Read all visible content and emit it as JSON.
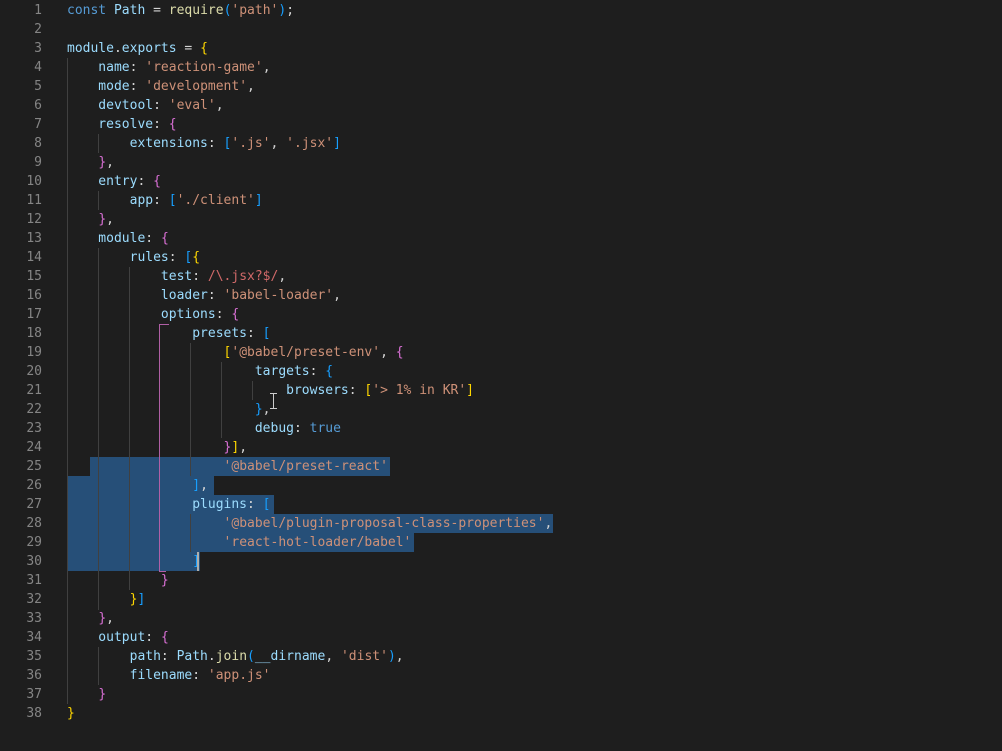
{
  "colors": {
    "background": "#1e1e1e",
    "line_number": "#858585",
    "keyword": "#569cd6",
    "variable": "#9cdcfe",
    "function": "#dcdcaa",
    "string": "#ce9178",
    "regex": "#d16969",
    "bracket_1": "#ffd700",
    "bracket_2": "#da70d6",
    "bracket_3": "#179fff",
    "plain": "#d4d4d4",
    "selection": "#264f78"
  },
  "editor": {
    "language": "javascript",
    "lines": [
      {
        "n": "1",
        "tokens": [
          [
            "const",
            "kw"
          ],
          [
            " Path ",
            "v"
          ],
          [
            "=",
            "p"
          ],
          [
            " ",
            "p"
          ],
          [
            "require",
            "fn"
          ],
          [
            "(",
            "b3"
          ],
          [
            "'path'",
            "s"
          ],
          [
            ")",
            "b3"
          ],
          [
            ";",
            "p"
          ]
        ]
      },
      {
        "n": "2",
        "tokens": []
      },
      {
        "n": "3",
        "tokens": [
          [
            "module",
            "v"
          ],
          [
            ".",
            "p"
          ],
          [
            "exports",
            "v"
          ],
          [
            " = ",
            "p"
          ],
          [
            "{",
            "b1"
          ]
        ]
      },
      {
        "n": "4",
        "tokens": [
          [
            "    name",
            "v"
          ],
          [
            ": ",
            "p"
          ],
          [
            "'reaction-game'",
            "s"
          ],
          [
            ",",
            "p"
          ]
        ]
      },
      {
        "n": "5",
        "tokens": [
          [
            "    mode",
            "v"
          ],
          [
            ": ",
            "p"
          ],
          [
            "'development'",
            "s"
          ],
          [
            ",",
            "p"
          ]
        ]
      },
      {
        "n": "6",
        "tokens": [
          [
            "    devtool",
            "v"
          ],
          [
            ": ",
            "p"
          ],
          [
            "'eval'",
            "s"
          ],
          [
            ",",
            "p"
          ]
        ]
      },
      {
        "n": "7",
        "tokens": [
          [
            "    resolve",
            "v"
          ],
          [
            ": ",
            "p"
          ],
          [
            "{",
            "b2"
          ]
        ]
      },
      {
        "n": "8",
        "tokens": [
          [
            "        extensions",
            "v"
          ],
          [
            ": ",
            "p"
          ],
          [
            "[",
            "b3"
          ],
          [
            "'.js'",
            "s"
          ],
          [
            ", ",
            "p"
          ],
          [
            "'.jsx'",
            "s"
          ],
          [
            "]",
            "b3"
          ]
        ]
      },
      {
        "n": "9",
        "tokens": [
          [
            "    ",
            "p"
          ],
          [
            "}",
            "b2"
          ],
          [
            ",",
            "p"
          ]
        ]
      },
      {
        "n": "10",
        "tokens": [
          [
            "    entry",
            "v"
          ],
          [
            ": ",
            "p"
          ],
          [
            "{",
            "b2"
          ]
        ]
      },
      {
        "n": "11",
        "tokens": [
          [
            "        app",
            "v"
          ],
          [
            ": ",
            "p"
          ],
          [
            "[",
            "b3"
          ],
          [
            "'./client'",
            "s"
          ],
          [
            "]",
            "b3"
          ]
        ]
      },
      {
        "n": "12",
        "tokens": [
          [
            "    ",
            "p"
          ],
          [
            "}",
            "b2"
          ],
          [
            ",",
            "p"
          ]
        ]
      },
      {
        "n": "13",
        "tokens": [
          [
            "    module",
            "v"
          ],
          [
            ": ",
            "p"
          ],
          [
            "{",
            "b2"
          ]
        ]
      },
      {
        "n": "14",
        "tokens": [
          [
            "        rules",
            "v"
          ],
          [
            ": ",
            "p"
          ],
          [
            "[",
            "b3"
          ],
          [
            "{",
            "b1"
          ]
        ]
      },
      {
        "n": "15",
        "tokens": [
          [
            "            test",
            "v"
          ],
          [
            ": ",
            "p"
          ],
          [
            "/\\.jsx?$/",
            "re"
          ],
          [
            ",",
            "p"
          ]
        ]
      },
      {
        "n": "16",
        "tokens": [
          [
            "            loader",
            "v"
          ],
          [
            ": ",
            "p"
          ],
          [
            "'babel-loader'",
            "s"
          ],
          [
            ",",
            "p"
          ]
        ]
      },
      {
        "n": "17",
        "tokens": [
          [
            "            options",
            "v"
          ],
          [
            ": ",
            "p"
          ],
          [
            "{",
            "b2"
          ]
        ]
      },
      {
        "n": "18",
        "tokens": [
          [
            "                presets",
            "v"
          ],
          [
            ": ",
            "p"
          ],
          [
            "[",
            "b3"
          ]
        ]
      },
      {
        "n": "19",
        "tokens": [
          [
            "                    ",
            "p"
          ],
          [
            "[",
            "b1"
          ],
          [
            "'@babel/preset-env'",
            "s"
          ],
          [
            ", ",
            "p"
          ],
          [
            "{",
            "b2"
          ]
        ]
      },
      {
        "n": "20",
        "tokens": [
          [
            "                        targets",
            "v"
          ],
          [
            ": ",
            "p"
          ],
          [
            "{",
            "b3"
          ]
        ]
      },
      {
        "n": "21",
        "tokens": [
          [
            "                            browsers",
            "v"
          ],
          [
            ": ",
            "p"
          ],
          [
            "[",
            "b1"
          ],
          [
            "'> 1% in KR'",
            "s"
          ],
          [
            "]",
            "b1"
          ]
        ]
      },
      {
        "n": "22",
        "tokens": [
          [
            "                        ",
            "p"
          ],
          [
            "}",
            "b3"
          ],
          [
            ",",
            "p"
          ]
        ]
      },
      {
        "n": "23",
        "tokens": [
          [
            "                        debug",
            "v"
          ],
          [
            ": ",
            "p"
          ],
          [
            "true",
            "kw"
          ]
        ]
      },
      {
        "n": "24",
        "tokens": [
          [
            "                    ",
            "p"
          ],
          [
            "}",
            "b2"
          ],
          [
            "]",
            "b1"
          ],
          [
            ",",
            "p"
          ]
        ]
      },
      {
        "n": "25",
        "tokens": [
          [
            "                    ",
            "p"
          ],
          [
            "'@babel/preset-react'",
            "s"
          ]
        ]
      },
      {
        "n": "26",
        "tokens": [
          [
            "                ",
            "p"
          ],
          [
            "]",
            "b3"
          ],
          [
            ",",
            "p"
          ]
        ]
      },
      {
        "n": "27",
        "tokens": [
          [
            "                plugins",
            "v"
          ],
          [
            ": ",
            "p"
          ],
          [
            "[",
            "b3"
          ]
        ]
      },
      {
        "n": "28",
        "tokens": [
          [
            "                    ",
            "p"
          ],
          [
            "'@babel/plugin-proposal-class-properties'",
            "s"
          ],
          [
            ",",
            "p"
          ]
        ]
      },
      {
        "n": "29",
        "tokens": [
          [
            "                    ",
            "p"
          ],
          [
            "'react-hot-loader/babel'",
            "s"
          ]
        ]
      },
      {
        "n": "30",
        "tokens": [
          [
            "                ",
            "p"
          ],
          [
            "]",
            "b3"
          ]
        ]
      },
      {
        "n": "31",
        "tokens": [
          [
            "            ",
            "p"
          ],
          [
            "}",
            "b2"
          ]
        ]
      },
      {
        "n": "32",
        "tokens": [
          [
            "        ",
            "p"
          ],
          [
            "}",
            "b1"
          ],
          [
            "]",
            "b3"
          ]
        ]
      },
      {
        "n": "33",
        "tokens": [
          [
            "    ",
            "p"
          ],
          [
            "}",
            "b2"
          ],
          [
            ",",
            "p"
          ]
        ]
      },
      {
        "n": "34",
        "tokens": [
          [
            "    output",
            "v"
          ],
          [
            ": ",
            "p"
          ],
          [
            "{",
            "b2"
          ]
        ]
      },
      {
        "n": "35",
        "tokens": [
          [
            "        path",
            "v"
          ],
          [
            ": ",
            "p"
          ],
          [
            "Path",
            "v"
          ],
          [
            ".",
            "p"
          ],
          [
            "join",
            "fn"
          ],
          [
            "(",
            "b3"
          ],
          [
            "__dirname",
            "v"
          ],
          [
            ", ",
            "p"
          ],
          [
            "'dist'",
            "s"
          ],
          [
            ")",
            "b3"
          ],
          [
            ",",
            "p"
          ]
        ]
      },
      {
        "n": "36",
        "tokens": [
          [
            "        filename",
            "v"
          ],
          [
            ": ",
            "p"
          ],
          [
            "'app.js'",
            "s"
          ]
        ]
      },
      {
        "n": "37",
        "tokens": [
          [
            "    ",
            "p"
          ],
          [
            "}",
            "b2"
          ]
        ]
      },
      {
        "n": "38",
        "tokens": [
          [
            "}",
            "b1"
          ]
        ]
      }
    ]
  }
}
